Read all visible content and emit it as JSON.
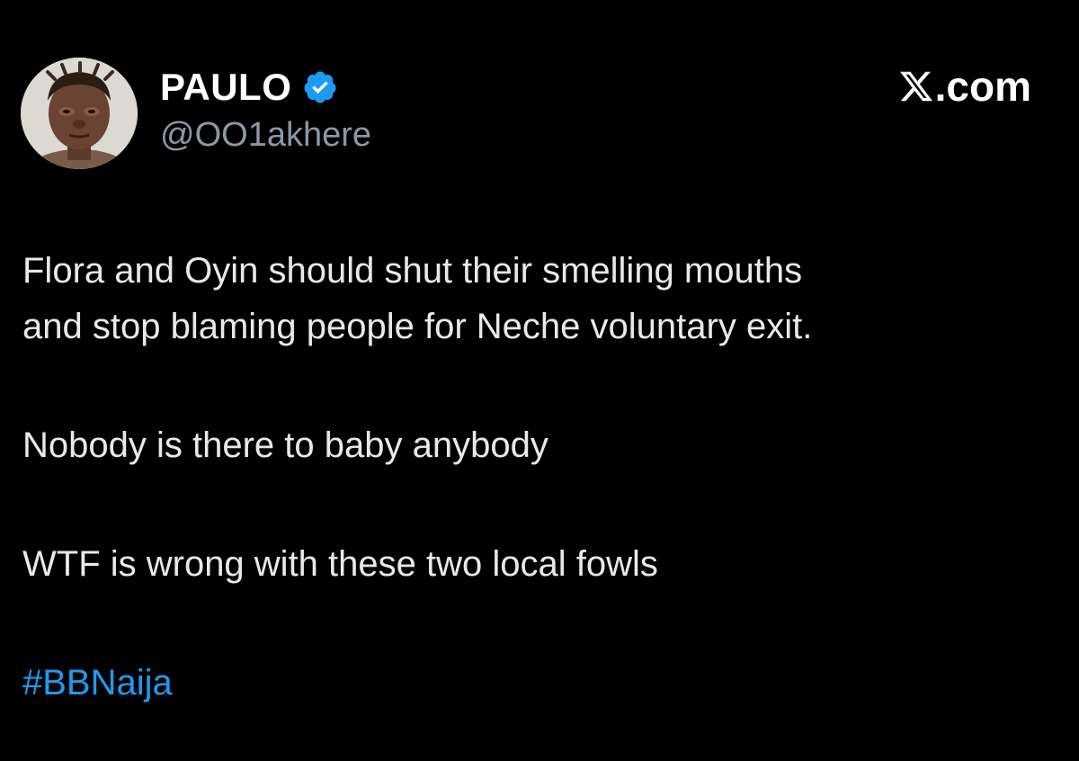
{
  "author": {
    "display_name": "PAULO",
    "handle": "@OO1akhere",
    "verified": true,
    "verified_color": "#1d9bf0",
    "avatar_icon": "user-avatar-photo"
  },
  "brand": {
    "icon": "x-logo-icon",
    "text": ".com"
  },
  "tweet": {
    "paragraph_1": {
      "line_1": "Flora and Oyin should shut their smelling mouths",
      "line_2": "and stop blaming people for Neche voluntary exit."
    },
    "paragraph_2": "Nobody is there to baby anybody",
    "paragraph_3": "WTF is wrong with these two local fowls",
    "hashtag": "#BBNaija"
  },
  "colors": {
    "background": "#000000",
    "text": "#e7e9ea",
    "secondary": "#8b98a5",
    "link": "#1d9bf0"
  }
}
